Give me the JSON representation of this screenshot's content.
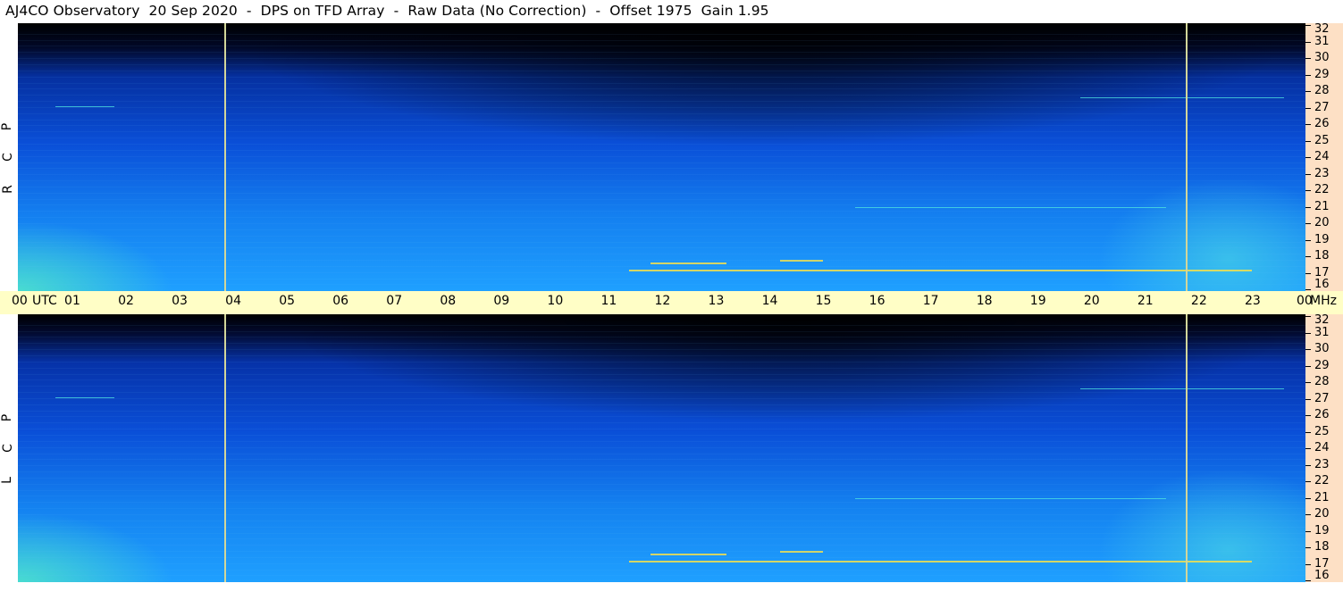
{
  "title": "AJ4CO Observatory  20 Sep 2020  -  DPS on TFD Array  -  Raw Data (No Correction)  -  Offset 1975  Gain 1.95",
  "panels": [
    {
      "polarization_label": [
        "R",
        "C",
        "P"
      ]
    },
    {
      "polarization_label": [
        "L",
        "C",
        "P"
      ]
    }
  ],
  "time_axis": {
    "labels": [
      "00",
      "UTC",
      "01",
      "02",
      "03",
      "04",
      "05",
      "06",
      "07",
      "08",
      "09",
      "10",
      "11",
      "12",
      "13",
      "14",
      "15",
      "16",
      "17",
      "18",
      "19",
      "20",
      "21",
      "22",
      "23",
      "00",
      "MHz"
    ]
  },
  "colors": {
    "background_deep": "#000000",
    "spectrum_mid": "#0a4fd8",
    "spectrum_low": "#1fa0ff",
    "emission_bright": "#50e6e0",
    "interference": "#f5e14c",
    "time_bar": "#fffec6",
    "freq_axis_bg": "#fde0c5",
    "cursor_line": "#d2d69a"
  },
  "chart_data": {
    "type": "heatmap",
    "title": "AJ4CO Observatory  20 Sep 2020  -  DPS on TFD Array  -  Raw Data (No Correction)  -  Offset 1975  Gain 1.95",
    "xlabel": "UTC",
    "ylabel": "MHz",
    "x_ticks": [
      "00",
      "01",
      "02",
      "03",
      "04",
      "05",
      "06",
      "07",
      "08",
      "09",
      "10",
      "11",
      "12",
      "13",
      "14",
      "15",
      "16",
      "17",
      "18",
      "19",
      "20",
      "21",
      "22",
      "23",
      "00"
    ],
    "y_ticks": [
      16,
      17,
      18,
      19,
      20,
      21,
      22,
      23,
      24,
      25,
      26,
      27,
      28,
      29,
      30,
      31,
      32
    ],
    "xlim_hours": [
      0,
      24
    ],
    "ylim_mhz": [
      16,
      32
    ],
    "panels": [
      "RCP",
      "LCP"
    ],
    "vertical_markers_hours": [
      3.85,
      21.77
    ],
    "features": [
      {
        "kind": "interference band",
        "freq_mhz": 17.2,
        "start_hour": 11.4,
        "end_hour": 23.0
      },
      {
        "kind": "interference band",
        "freq_mhz": 17.6,
        "start_hour": 11.8,
        "end_hour": 13.2
      },
      {
        "kind": "interference band",
        "freq_mhz": 17.8,
        "start_hour": 14.2,
        "end_hour": 15.0
      },
      {
        "kind": "emission streak",
        "freq_mhz": 27.6,
        "start_hour": 19.8,
        "end_hour": 23.6
      },
      {
        "kind": "emission streak",
        "freq_mhz": 21.0,
        "start_hour": 15.6,
        "end_hour": 21.4
      },
      {
        "kind": "emission streak",
        "freq_mhz": 27.1,
        "start_hour": 0.7,
        "end_hour": 1.8
      }
    ]
  }
}
